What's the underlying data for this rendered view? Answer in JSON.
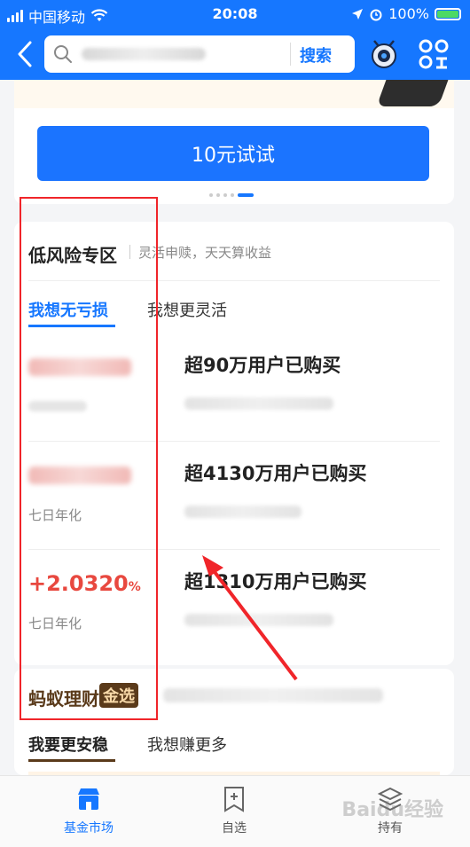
{
  "status_bar": {
    "carrier": "中国移动",
    "time": "20:08",
    "battery": "100%"
  },
  "nav": {
    "search_button": "搜索"
  },
  "banner": {
    "button_label": "10元试试"
  },
  "low_risk": {
    "title": "低风险专区",
    "subtitle": "灵活申赎，天天算收益",
    "tabs": [
      "我想无亏损",
      "我想更灵活"
    ],
    "products": [
      {
        "rate": "",
        "rate_label": "",
        "buyers": "超90万用户已购买"
      },
      {
        "rate": "",
        "rate_label": "七日年化",
        "buyers": "超4130万用户已购买"
      },
      {
        "rate": "+2.0320",
        "rate_suffix": "%",
        "rate_label": "七日年化",
        "buyers": "超1310万用户已购买"
      }
    ]
  },
  "ant": {
    "title": "蚂蚁理财",
    "badge": "金选",
    "tabs": [
      "我要更安稳",
      "我想赚更多"
    ]
  },
  "tab_bar": {
    "items": [
      {
        "label": "基金市场",
        "icon": "store-icon"
      },
      {
        "label": "自选",
        "icon": "bookmark-add-icon"
      },
      {
        "label": "持有",
        "icon": "layers-icon"
      }
    ],
    "watermark": "Baidu经验"
  },
  "colors": {
    "primary": "#1677ff",
    "rise": "#e8483f",
    "ant_brown": "#5a3a1a",
    "annotation": "#f0252a"
  }
}
